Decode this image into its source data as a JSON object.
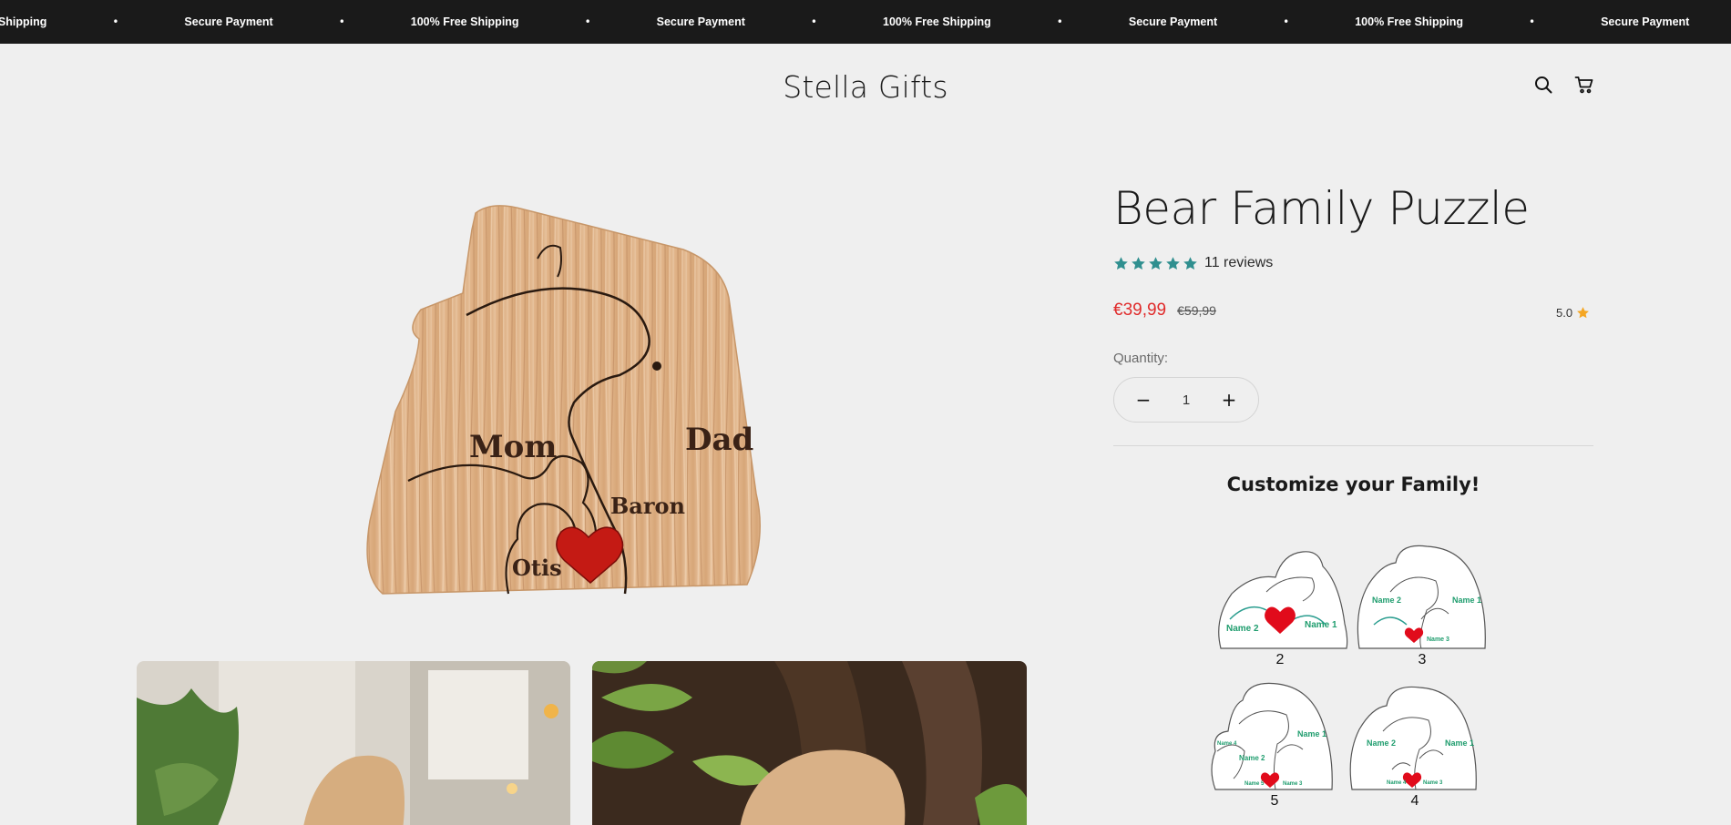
{
  "announcement": {
    "items": [
      "Free Shipping",
      "Secure Payment",
      "100% Free Shipping",
      "Secure Payment",
      "100% Free Shipping",
      "Secure Payment",
      "100% Free Shipping",
      "Secure Payment"
    ]
  },
  "header": {
    "logo": "Stella Gifts",
    "icons": [
      "search-icon",
      "cart-icon"
    ]
  },
  "product": {
    "title": "Bear Family Puzzle",
    "rating_stars": 5,
    "star_color": "#2f8f8f",
    "reviews": "11 reviews",
    "price": "€39,99",
    "compare_price": "€59,99",
    "price_color": "#e02b2b",
    "score": "5.0",
    "score_star_color": "#f5a623",
    "quantity_label": "Quantity:",
    "quantity": "1",
    "minus": "−",
    "plus": "+"
  },
  "main_image": {
    "engraved_names": [
      "Mom",
      "Dad",
      "Baron",
      "Otis"
    ]
  },
  "customize": {
    "title": "Customize your Family!",
    "options": [
      {
        "number": "2",
        "names": [
          "Name 2",
          "Name 1"
        ]
      },
      {
        "number": "3",
        "names": [
          "Name 2",
          "Name 1",
          "Name 3"
        ]
      },
      {
        "number": "5",
        "names": [
          "Name 4",
          "Name 2",
          "Name 1",
          "Name 5",
          "Name 3"
        ]
      },
      {
        "number": "4",
        "names": [
          "Name 2",
          "Name 1",
          "Name 4",
          "Name 3"
        ]
      }
    ]
  }
}
